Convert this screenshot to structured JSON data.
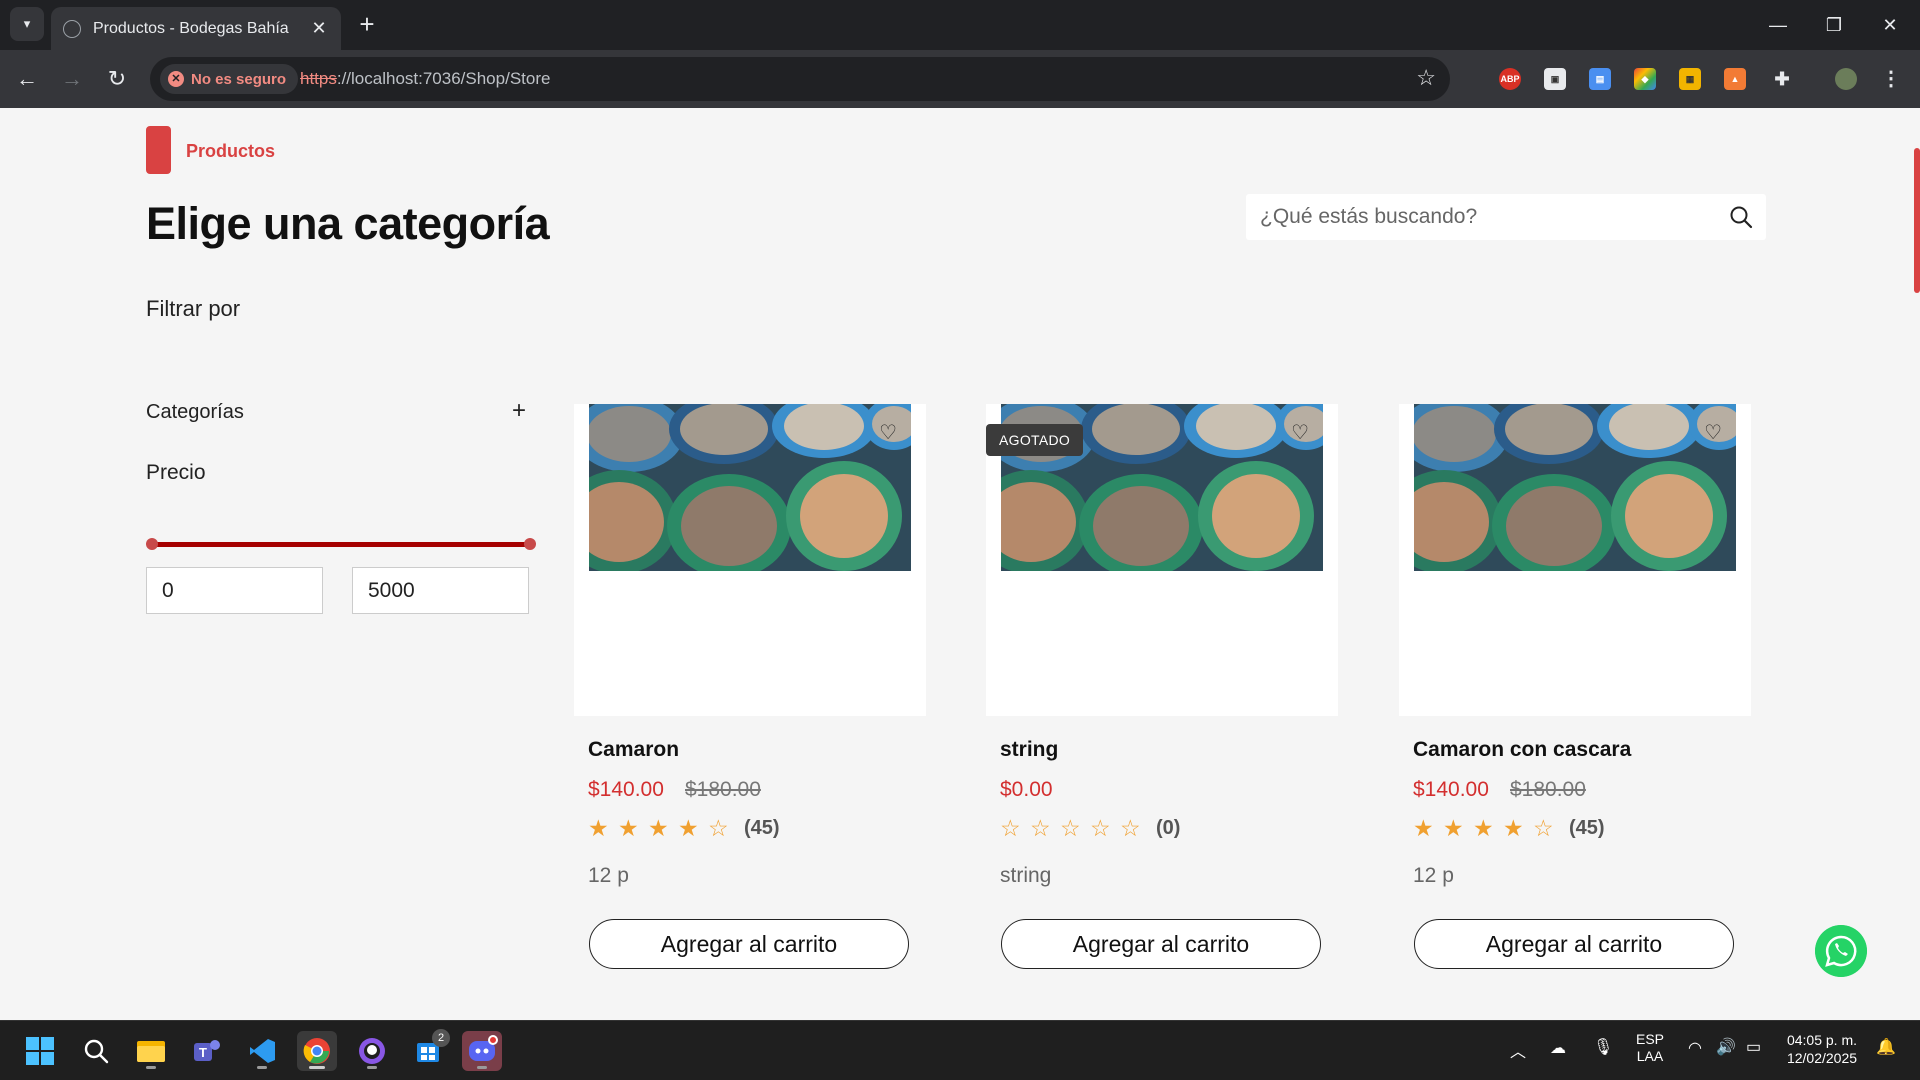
{
  "browser": {
    "tab_title": "Productos - Bodegas Bahía",
    "security_label": "No es seguro",
    "url_scheme": "https",
    "url_rest": "://localhost:7036/Shop/Store"
  },
  "breadcrumb": {
    "label": "Productos"
  },
  "page_title": "Elige una categoría",
  "search": {
    "placeholder": "¿Qué estás buscando?"
  },
  "filters": {
    "heading": "Filtrar por",
    "categories_label": "Categorías",
    "categories_toggle": "+",
    "price_label": "Precio",
    "price_min": "0",
    "price_max": "5000"
  },
  "products": [
    {
      "name": "Camaron",
      "price": "$140.00",
      "old_price": "$180.00",
      "rating": 4,
      "reviews": "(45)",
      "description": "12 p",
      "badge": "",
      "button": "Agregar al carrito"
    },
    {
      "name": "string",
      "price": "$0.00",
      "old_price": "",
      "rating": 0,
      "reviews": "(0)",
      "description": "string",
      "badge": "AGOTADO",
      "button": "Agregar al carrito"
    },
    {
      "name": "Camaron con cascara",
      "price": "$140.00",
      "old_price": "$180.00",
      "rating": 4,
      "reviews": "(45)",
      "description": "12 p",
      "badge": "",
      "button": "Agregar al carrito"
    }
  ],
  "taskbar": {
    "apps": [
      "windows-start",
      "search",
      "file-explorer",
      "teams",
      "vscode",
      "chrome",
      "github",
      "app-store",
      "discord"
    ],
    "store_badge": "2",
    "language": "ESP",
    "layout": "LAA",
    "time": "04:05 p. m.",
    "date": "12/02/2025"
  },
  "colors": {
    "accent_red": "#d94242",
    "price_red": "#d32f2f",
    "star": "#f0a030",
    "whatsapp_green": "#25d366"
  }
}
